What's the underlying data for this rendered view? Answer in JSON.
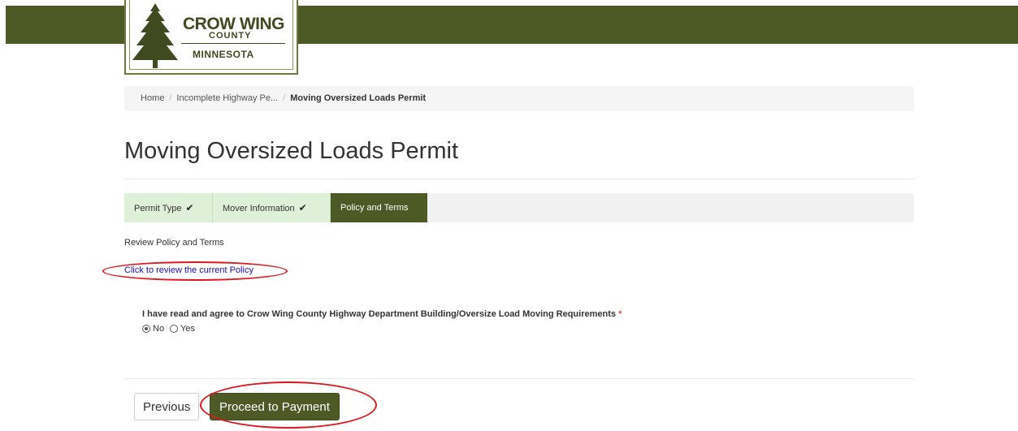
{
  "logo": {
    "line1": "CROW WING",
    "line2": "COUNTY",
    "line3": "MINNESOTA"
  },
  "breadcrumb": {
    "items": [
      "Home",
      "Incomplete Highway Pe...",
      "Moving Oversized Loads Permit"
    ]
  },
  "page": {
    "title": "Moving Oversized Loads Permit"
  },
  "wizard": {
    "steps": [
      {
        "label": "Permit Type",
        "state": "done",
        "icon": "check-icon"
      },
      {
        "label": "Mover Information",
        "state": "done",
        "icon": "check-icon"
      },
      {
        "label": "Policy and Terms",
        "state": "current"
      }
    ]
  },
  "policy": {
    "section_label": "Review Policy and Terms",
    "link_text": "Click to review the current Policy",
    "question": "I have read and agree to Crow Wing County Highway Department Building/Oversize Load Moving Requirements",
    "required_marker": "*",
    "options": [
      {
        "label": "No",
        "selected": true
      },
      {
        "label": "Yes",
        "selected": false
      }
    ]
  },
  "actions": {
    "previous_label": "Previous",
    "proceed_label": "Proceed to Payment"
  },
  "colors": {
    "brand_green": "#4e5a26",
    "step_done_bg": "#dff0d8",
    "link_blue": "#1a0dab",
    "annotation_red": "#e0151d",
    "required_red": "#d9534f"
  }
}
